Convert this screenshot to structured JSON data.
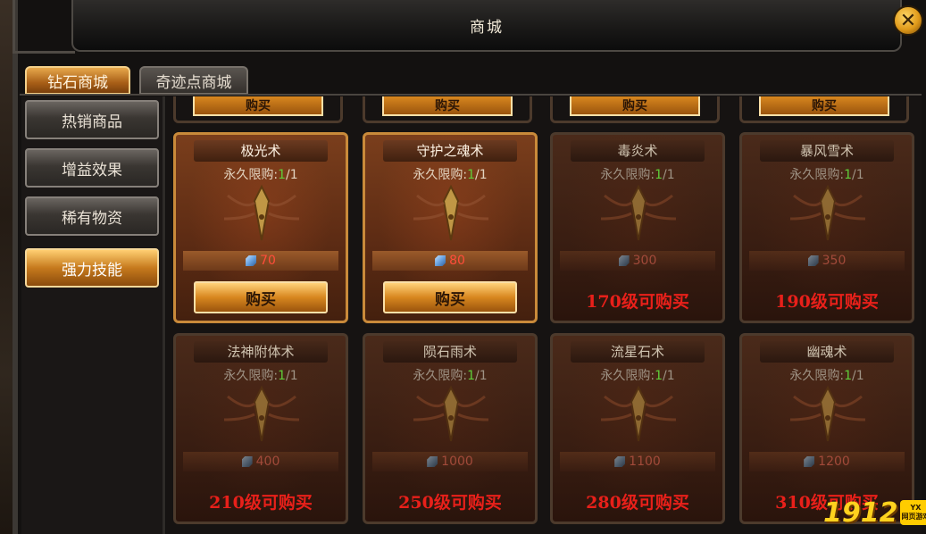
{
  "window": {
    "title": "商城"
  },
  "tabs": [
    {
      "label": "钻石商城",
      "active": true
    },
    {
      "label": "奇迹点商城",
      "active": false
    }
  ],
  "sidebar": {
    "items": [
      {
        "label": "热销商品",
        "active": false
      },
      {
        "label": "增益效果",
        "active": false
      },
      {
        "label": "稀有物资",
        "active": false
      },
      {
        "label": "强力技能",
        "active": true
      }
    ]
  },
  "top_row_partial": {
    "buy_label": "购买"
  },
  "limit_label": "永久限购:",
  "items": [
    {
      "name": "极光术",
      "limit_count": "1",
      "limit_total": "/1",
      "price": "70",
      "buy_label": "购买",
      "level_text": "",
      "available": true
    },
    {
      "name": "守护之魂术",
      "limit_count": "1",
      "limit_total": "/1",
      "price": "80",
      "buy_label": "购买",
      "level_text": "",
      "available": true
    },
    {
      "name": "毒炎术",
      "limit_count": "1",
      "limit_total": "/1",
      "price": "300",
      "buy_label": "",
      "level_text": "170级可购买",
      "available": false
    },
    {
      "name": "暴风雪术",
      "limit_count": "1",
      "limit_total": "/1",
      "price": "350",
      "buy_label": "",
      "level_text": "190级可购买",
      "available": false
    },
    {
      "name": "法神附体术",
      "limit_count": "1",
      "limit_total": "/1",
      "price": "400",
      "buy_label": "",
      "level_text": "210级可购买",
      "available": false
    },
    {
      "name": "陨石雨术",
      "limit_count": "1",
      "limit_total": "/1",
      "price": "1000",
      "buy_label": "",
      "level_text": "250级可购买",
      "available": false
    },
    {
      "name": "流星石术",
      "limit_count": "1",
      "limit_total": "/1",
      "price": "1100",
      "buy_label": "",
      "level_text": "280级可购买",
      "available": false
    },
    {
      "name": "幽魂术",
      "limit_count": "1",
      "limit_total": "/1",
      "price": "1200",
      "buy_label": "",
      "level_text": "310级可购买",
      "available": false
    }
  ],
  "watermark": {
    "number": "1912",
    "badge_top": "YX",
    "badge_bottom": "网页游戏"
  },
  "colors": {
    "accent_gold": "#d8871f",
    "price_red": "#ff4d3a",
    "level_red": "#e8201a",
    "limit_green": "#5fcf3a"
  }
}
